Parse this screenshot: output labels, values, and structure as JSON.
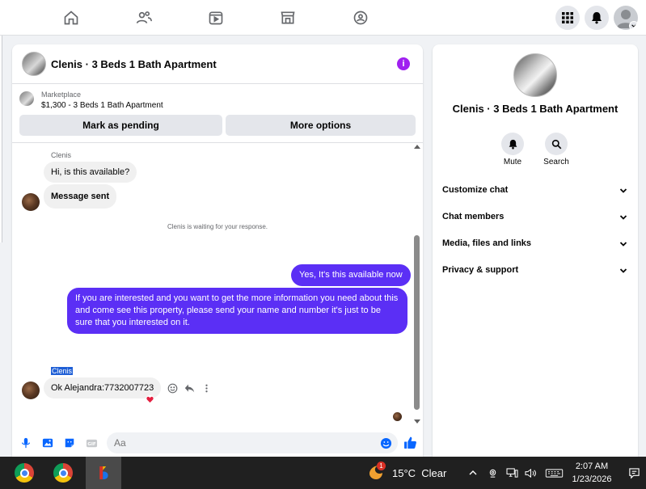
{
  "header": {
    "title": "Clenis · 3 Beds 1 Bath Apartment",
    "info_icon": "i"
  },
  "marketplace": {
    "label": "Marketplace",
    "listing": "$1,300 - 3 Beds 1 Bath Apartment",
    "mark_pending_label": "Mark as pending",
    "more_options_label": "More options"
  },
  "messages": {
    "sender_name_1": "Clenis",
    "in_1": "Hi, is this available?",
    "in_2": "Message sent",
    "system_note": "Clenis is waiting for your response.",
    "out_1": "Yes, It's this available now",
    "out_2": "If you are interested and you want to get the more information you need about this and come see this property, please send your name and number it's just to be sure that you interested on it.",
    "sender_name_2": "Clenis",
    "in_3": "Ok Alejandra:7732007723"
  },
  "composer": {
    "placeholder": "Aa"
  },
  "right_panel": {
    "title": "Clenis · 3 Beds 1 Bath Apartment",
    "mute_label": "Mute",
    "search_label": "Search",
    "sections": [
      {
        "label": "Customize chat"
      },
      {
        "label": "Chat members"
      },
      {
        "label": "Media, files and links"
      },
      {
        "label": "Privacy & support"
      }
    ]
  },
  "taskbar": {
    "weather_badge": "1",
    "weather": "15°C  Clear",
    "time": "2:07 AM",
    "date": "1/23/2026"
  },
  "colors": {
    "accent": "#5b2ff5",
    "info": "#a020f0",
    "like": "#0866ff",
    "reaction": "#e41e3f"
  }
}
